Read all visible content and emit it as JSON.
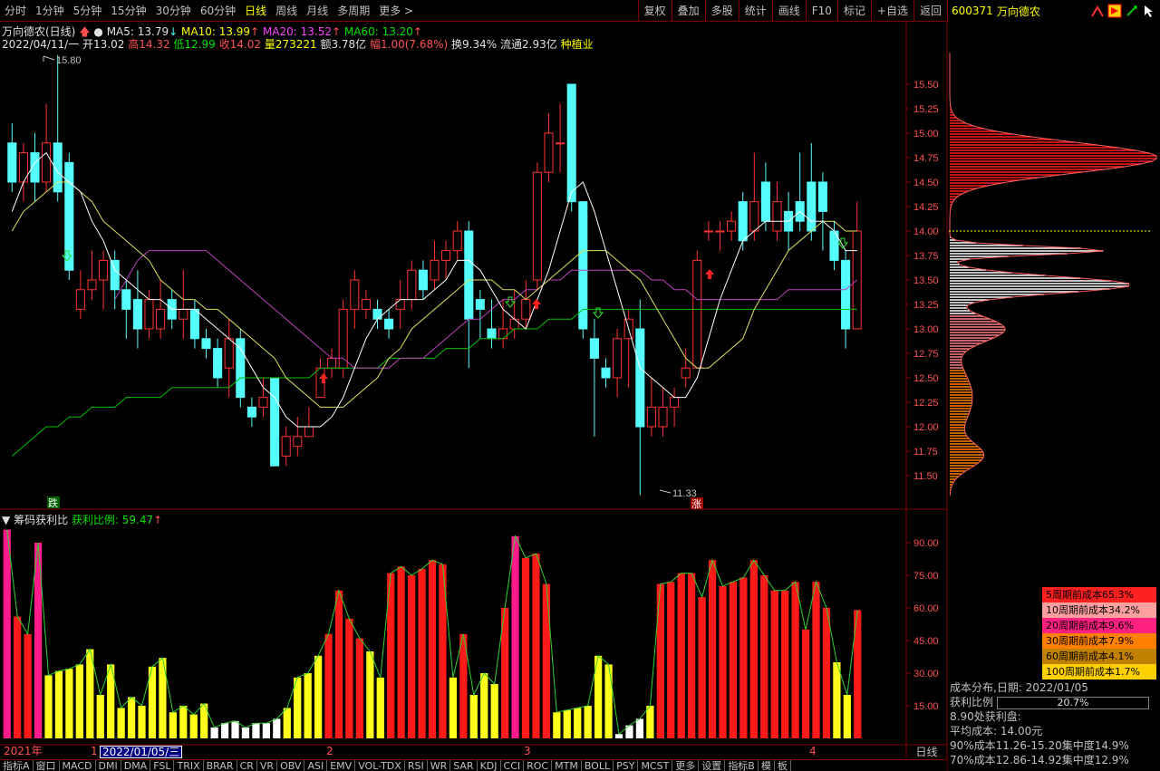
{
  "toolbar": {
    "left_items": [
      "分时",
      "1分钟",
      "5分钟",
      "15分钟",
      "30分钟",
      "60分钟",
      "日线",
      "周线",
      "月线",
      "多周期",
      "更多 >"
    ],
    "active": "日线",
    "right_items": [
      "复权",
      "叠加",
      "多股",
      "统计",
      "画线",
      "F10",
      "标记",
      "+自选",
      "返回"
    ]
  },
  "stock": {
    "code": "600371",
    "name": "万向德农"
  },
  "main_info": {
    "title": "万向德农(日线)",
    "ma5_label": "MA5: 13.79",
    "ma10_label": "MA10: 13.99",
    "ma20_label": "MA20: 13.52",
    "ma60_label": "MA60: 13.20",
    "date": "2022/04/11/一",
    "open": "开13.02",
    "high": "高14.32",
    "low": "低12.99",
    "close": "收14.02",
    "volume": "量273221",
    "amount": "额3.78亿",
    "change": "幅1.00(7.68%)",
    "turnover": "换9.34%",
    "float": "流通2.93亿",
    "sector": "种植业"
  },
  "sub_info": {
    "title": "筹码获利比",
    "ratio_label": "获利比例: 59.47"
  },
  "markers": {
    "high_label": "15.80",
    "low_label": "11.33",
    "down_tag": "跌",
    "up_tag": "涨"
  },
  "price_axis": [
    "15.50",
    "15.25",
    "15.00",
    "14.75",
    "14.50",
    "14.25",
    "14.00",
    "13.75",
    "13.50",
    "13.25",
    "13.00",
    "12.75",
    "12.50",
    "12.25",
    "12.00",
    "11.75",
    "11.50"
  ],
  "sub_axis": [
    "90.00",
    "75.00",
    "60.00",
    "45.00",
    "30.00",
    "15.00"
  ],
  "date_bar": {
    "year": "2021年",
    "m1": "1",
    "current": "2022/01/05/三",
    "m2": "2",
    "m3": "3",
    "m4": "4"
  },
  "period_label": "日线",
  "cost_legend": [
    {
      "label": "5周期前成本65.3%",
      "color": "#ff2020"
    },
    {
      "label": "10周期前成本34.2%",
      "color": "#ffa0a0"
    },
    {
      "label": "20周期前成本9.6%",
      "color": "#ff2080"
    },
    {
      "label": "30周期前成本7.9%",
      "color": "#ff8000"
    },
    {
      "label": "60周期前成本4.1%",
      "color": "#c08000"
    },
    {
      "label": "100周期前成本1.7%",
      "color": "#ffd000"
    }
  ],
  "cost_info": {
    "title": "成本分布,日期: 2022/01/05",
    "profit_label": "获利比例",
    "profit_value": "20.7%",
    "line3": "8.90处获利盘:",
    "line4": "平均成本: 14.00元",
    "line5": "90%成本11.26-15.20集中度14.9%",
    "line6": "70%成本12.86-14.92集中度12.9%"
  },
  "bottom_tabs": [
    "指标A",
    "窗口",
    "MACD",
    "DMI",
    "DMA",
    "FSL",
    "TRIX",
    "BRAR",
    "CR",
    "VR",
    "OBV",
    "ASI",
    "EMV",
    "VOL-TDX",
    "RSI",
    "WR",
    "SAR",
    "KDJ",
    "CCI",
    "ROC",
    "MTM",
    "BOLL",
    "PSY",
    "MCST",
    "更多",
    "设置",
    "指标B",
    "模",
    "板"
  ],
  "chart_data": {
    "type": "candlestick",
    "price_range": [
      11.2,
      15.9
    ],
    "profit_range": [
      0,
      100
    ],
    "candles": [
      [
        14.9,
        14.5,
        15.1,
        14.4
      ],
      [
        14.5,
        14.8,
        14.9,
        14.3
      ],
      [
        14.8,
        14.5,
        15.0,
        14.3
      ],
      [
        14.5,
        14.9,
        15.3,
        14.4
      ],
      [
        14.9,
        14.4,
        15.8,
        14.3
      ],
      [
        14.7,
        13.6,
        14.8,
        13.5
      ],
      [
        13.2,
        13.4,
        13.6,
        13.1
      ],
      [
        13.4,
        13.5,
        13.8,
        13.3
      ],
      [
        13.5,
        13.7,
        13.8,
        13.2
      ],
      [
        13.7,
        13.4,
        13.8,
        13.2
      ],
      [
        13.4,
        13.2,
        13.5,
        12.9
      ],
      [
        13.3,
        13.0,
        13.6,
        12.8
      ],
      [
        13.0,
        13.3,
        13.4,
        12.9
      ],
      [
        13.0,
        13.2,
        13.5,
        12.9
      ],
      [
        13.3,
        13.1,
        13.4,
        13.0
      ],
      [
        13.1,
        13.2,
        13.6,
        12.9
      ],
      [
        13.2,
        12.9,
        13.3,
        12.8
      ],
      [
        12.9,
        12.8,
        13.0,
        12.7
      ],
      [
        12.8,
        12.5,
        12.9,
        12.4
      ],
      [
        12.6,
        12.9,
        13.1,
        12.3
      ],
      [
        12.9,
        12.3,
        13.0,
        12.2
      ],
      [
        12.2,
        12.1,
        12.3,
        12.0
      ],
      [
        12.2,
        12.3,
        12.5,
        12.1
      ],
      [
        12.5,
        11.6,
        12.5,
        11.6
      ],
      [
        11.7,
        11.9,
        12.0,
        11.6
      ],
      [
        11.8,
        11.9,
        12.1,
        11.7
      ],
      [
        11.9,
        12.0,
        12.2,
        11.9
      ],
      [
        12.3,
        12.6,
        12.7,
        12.3
      ],
      [
        12.6,
        12.7,
        12.8,
        12.5
      ],
      [
        12.6,
        13.2,
        13.3,
        12.5
      ],
      [
        13.2,
        13.5,
        13.6,
        13.0
      ],
      [
        13.2,
        13.3,
        13.4,
        13.1
      ],
      [
        13.2,
        13.1,
        13.3,
        13.0
      ],
      [
        13.1,
        13.0,
        13.2,
        12.9
      ],
      [
        13.2,
        13.3,
        13.5,
        13.0
      ],
      [
        13.3,
        13.6,
        13.7,
        13.2
      ],
      [
        13.6,
        13.4,
        13.7,
        13.3
      ],
      [
        13.5,
        13.7,
        13.9,
        13.4
      ],
      [
        13.7,
        13.8,
        13.9,
        13.5
      ],
      [
        13.8,
        14.0,
        14.1,
        13.7
      ],
      [
        14.0,
        13.1,
        14.1,
        12.6
      ],
      [
        13.3,
        13.2,
        13.4,
        12.9
      ],
      [
        13.0,
        12.9,
        13.3,
        12.8
      ],
      [
        12.9,
        13.0,
        13.3,
        12.8
      ],
      [
        13.0,
        13.1,
        13.4,
        12.9
      ],
      [
        13.1,
        13.3,
        13.5,
        13.0
      ],
      [
        13.5,
        14.6,
        14.7,
        13.4
      ],
      [
        14.6,
        15.0,
        15.2,
        14.5
      ],
      [
        14.9,
        14.9,
        15.3,
        14.6
      ],
      [
        15.5,
        14.3,
        15.5,
        14.2
      ],
      [
        14.3,
        13.0,
        14.3,
        12.9
      ],
      [
        12.9,
        12.7,
        13.1,
        11.9
      ],
      [
        12.6,
        12.5,
        12.7,
        12.4
      ],
      [
        12.5,
        12.9,
        13.0,
        12.3
      ],
      [
        12.9,
        13.1,
        13.2,
        12.4
      ],
      [
        13.0,
        12.0,
        13.3,
        11.3
      ],
      [
        12.0,
        12.2,
        12.5,
        11.9
      ],
      [
        12.0,
        12.2,
        12.4,
        11.9
      ],
      [
        12.2,
        12.3,
        12.4,
        12.0
      ],
      [
        12.5,
        12.6,
        12.8,
        12.4
      ],
      [
        12.6,
        13.7,
        13.8,
        12.6
      ],
      [
        14.0,
        14.0,
        14.1,
        13.9
      ],
      [
        14.0,
        14.0,
        14.1,
        13.8
      ],
      [
        14.0,
        14.1,
        14.2,
        13.9
      ],
      [
        14.3,
        13.9,
        14.4,
        13.8
      ],
      [
        14.0,
        14.3,
        14.8,
        13.9
      ],
      [
        14.5,
        14.1,
        14.7,
        14.0
      ],
      [
        14.0,
        14.3,
        14.5,
        13.9
      ],
      [
        14.2,
        14.0,
        14.4,
        13.8
      ],
      [
        14.3,
        14.1,
        14.8,
        14.0
      ],
      [
        14.5,
        14.0,
        14.9,
        13.9
      ],
      [
        14.5,
        14.2,
        14.6,
        13.8
      ],
      [
        14.0,
        13.7,
        14.1,
        13.6
      ],
      [
        13.7,
        13.0,
        13.8,
        12.8
      ],
      [
        13.0,
        14.0,
        14.3,
        13.0
      ]
    ],
    "ma5": [
      14.2,
      14.5,
      14.7,
      14.8,
      14.6,
      14.5,
      14.4,
      14.1,
      13.9,
      13.6,
      13.5,
      13.4,
      13.3,
      13.3,
      13.2,
      13.2,
      13.2,
      13.1,
      13.0,
      12.9,
      12.8,
      12.6,
      12.4,
      12.3,
      12.1,
      12.0,
      12.0,
      12.0,
      12.1,
      12.3,
      12.6,
      12.9,
      13.1,
      13.2,
      13.3,
      13.3,
      13.3,
      13.4,
      13.5,
      13.7,
      13.7,
      13.6,
      13.4,
      13.2,
      13.1,
      13.0,
      13.3,
      13.6,
      14.0,
      14.4,
      14.5,
      14.2,
      13.8,
      13.4,
      13.0,
      12.6,
      12.5,
      12.4,
      12.3,
      12.3,
      12.5,
      12.9,
      13.3,
      13.6,
      13.9,
      14.0,
      14.1,
      14.1,
      14.1,
      14.2,
      14.1,
      14.1,
      14.0,
      13.8,
      13.8
    ],
    "ma10": [
      14.0,
      14.2,
      14.3,
      14.4,
      14.5,
      14.5,
      14.4,
      14.3,
      14.1,
      14.0,
      13.9,
      13.8,
      13.7,
      13.5,
      13.4,
      13.3,
      13.3,
      13.2,
      13.2,
      13.1,
      13.0,
      12.9,
      12.8,
      12.7,
      12.5,
      12.4,
      12.3,
      12.2,
      12.2,
      12.2,
      12.3,
      12.4,
      12.5,
      12.7,
      12.8,
      13.0,
      13.1,
      13.2,
      13.3,
      13.4,
      13.5,
      13.5,
      13.5,
      13.4,
      13.4,
      13.3,
      13.4,
      13.5,
      13.6,
      13.7,
      13.8,
      13.8,
      13.8,
      13.7,
      13.6,
      13.5,
      13.3,
      13.1,
      12.9,
      12.7,
      12.6,
      12.6,
      12.7,
      12.8,
      12.9,
      13.2,
      13.4,
      13.6,
      13.8,
      13.9,
      14.0,
      14.1,
      14.1,
      14.0,
      14.0
    ],
    "ma20": [
      null,
      null,
      null,
      null,
      null,
      null,
      null,
      null,
      null,
      13.3,
      13.5,
      13.7,
      13.8,
      13.8,
      13.8,
      13.8,
      13.8,
      13.8,
      13.7,
      13.6,
      13.5,
      13.4,
      13.3,
      13.2,
      13.1,
      13.0,
      12.9,
      12.8,
      12.7,
      12.7,
      12.6,
      12.6,
      12.6,
      12.6,
      12.7,
      12.7,
      12.7,
      12.8,
      12.9,
      13.0,
      13.1,
      13.1,
      13.2,
      13.3,
      13.3,
      13.4,
      13.4,
      13.5,
      13.5,
      13.6,
      13.6,
      13.6,
      13.6,
      13.6,
      13.6,
      13.6,
      13.5,
      13.5,
      13.4,
      13.4,
      13.3,
      13.3,
      13.3,
      13.3,
      13.3,
      13.3,
      13.3,
      13.3,
      13.4,
      13.4,
      13.4,
      13.4,
      13.4,
      13.4,
      13.5
    ],
    "ma60": [
      11.7,
      11.8,
      11.9,
      12.0,
      12.0,
      12.1,
      12.1,
      12.2,
      12.2,
      12.2,
      12.3,
      12.3,
      12.3,
      12.3,
      12.4,
      12.4,
      12.4,
      12.4,
      12.4,
      12.4,
      12.5,
      12.5,
      12.5,
      12.5,
      12.5,
      12.5,
      12.5,
      12.6,
      12.6,
      12.6,
      12.6,
      12.6,
      12.6,
      12.7,
      12.7,
      12.7,
      12.7,
      12.7,
      12.8,
      12.8,
      12.8,
      12.9,
      12.9,
      12.9,
      13.0,
      13.0,
      13.0,
      13.1,
      13.1,
      13.1,
      13.2,
      13.2,
      13.2,
      13.2,
      13.2,
      13.2,
      13.2,
      13.2,
      13.2,
      13.2,
      13.2,
      13.2,
      13.2,
      13.2,
      13.2,
      13.2,
      13.2,
      13.2,
      13.2,
      13.2,
      13.2,
      13.2,
      13.2,
      13.2,
      13.2
    ],
    "profit": [
      96,
      56,
      48,
      90,
      29,
      31,
      32,
      34,
      41,
      20,
      34,
      14,
      19,
      15,
      33,
      37,
      12,
      15,
      11,
      16,
      5,
      7,
      8,
      5,
      7,
      7,
      9,
      14,
      28,
      30,
      38,
      48,
      68,
      55,
      46,
      40,
      28,
      76,
      79,
      75,
      78,
      82,
      80,
      28,
      48,
      20,
      30,
      25,
      60,
      93,
      83,
      85,
      71,
      12,
      13,
      14,
      15,
      38,
      34,
      2,
      6,
      9,
      15,
      71,
      72,
      76,
      76,
      65,
      82,
      70,
      72,
      74,
      82,
      75,
      68,
      68,
      72,
      50,
      72,
      60,
      35,
      20,
      59
    ],
    "profit_colors": [
      "m",
      "r",
      "r",
      "m",
      "y",
      "y",
      "y",
      "y",
      "y",
      "y",
      "y",
      "y",
      "y",
      "y",
      "y",
      "y",
      "y",
      "y",
      "y",
      "y",
      "w",
      "w",
      "w",
      "w",
      "w",
      "w",
      "w",
      "y",
      "y",
      "y",
      "y",
      "r",
      "r",
      "r",
      "r",
      "y",
      "y",
      "r",
      "r",
      "r",
      "r",
      "r",
      "r",
      "y",
      "r",
      "y",
      "y",
      "y",
      "r",
      "m",
      "r",
      "r",
      "r",
      "y",
      "y",
      "y",
      "y",
      "y",
      "y",
      "w",
      "w",
      "w",
      "y",
      "r",
      "r",
      "r",
      "r",
      "r",
      "r",
      "r",
      "r",
      "r",
      "r",
      "r",
      "r",
      "r",
      "r",
      "r",
      "r",
      "r",
      "y",
      "y",
      "r"
    ]
  }
}
